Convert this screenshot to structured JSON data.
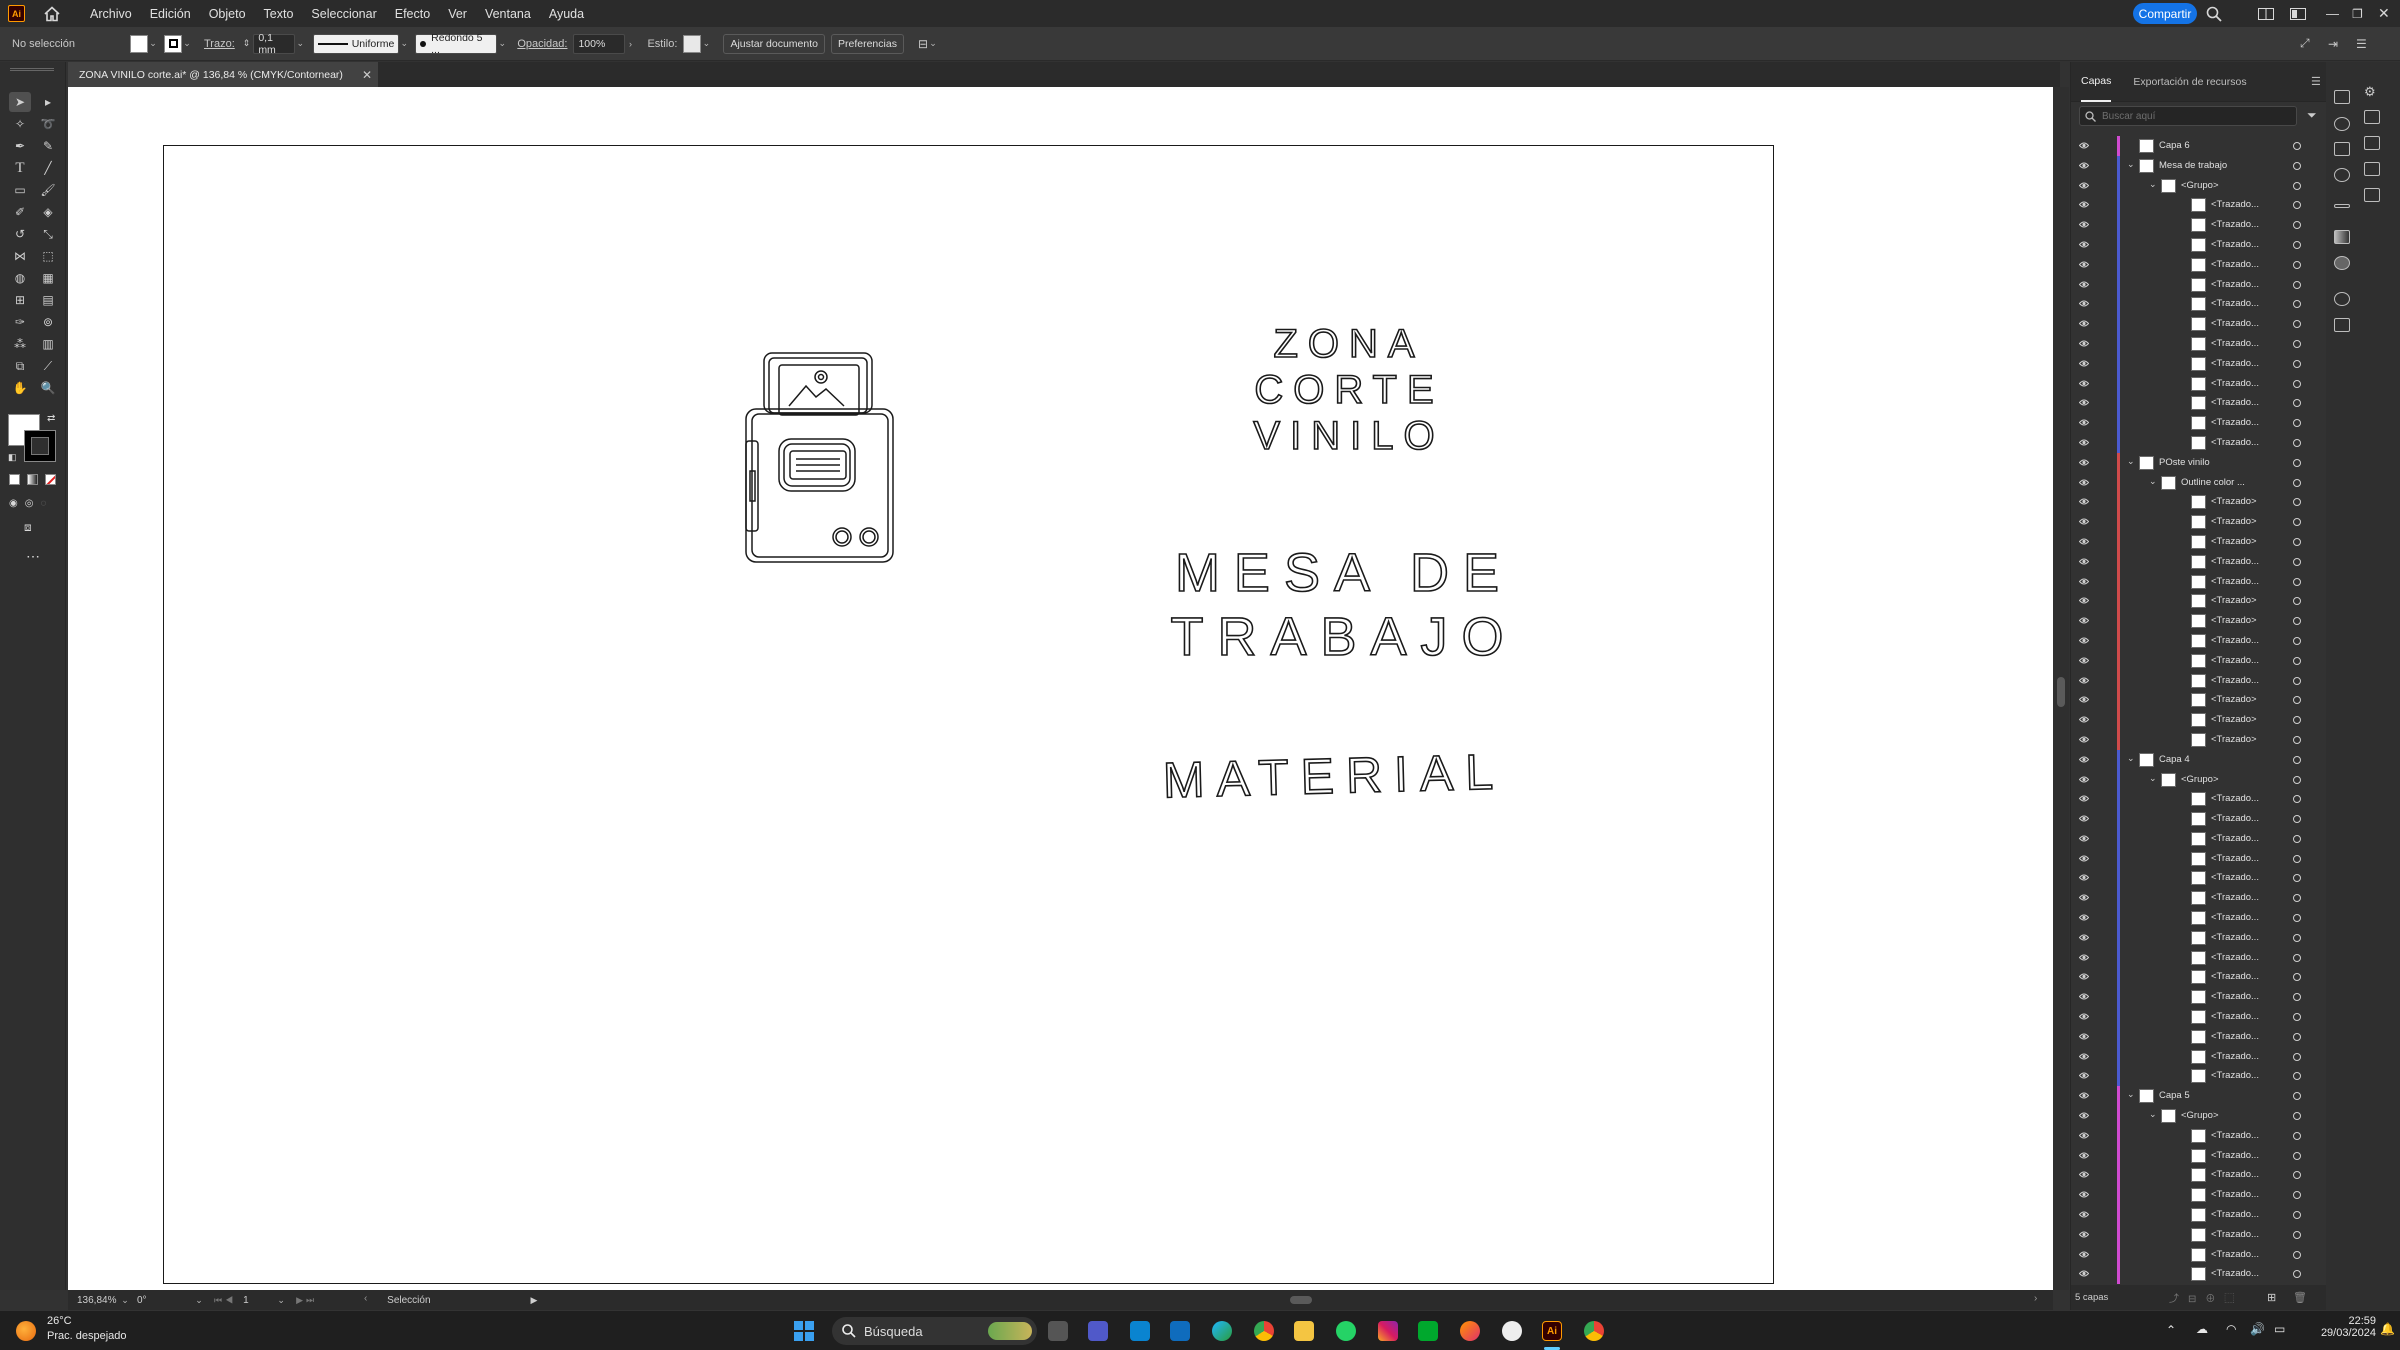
{
  "app": {
    "logo": "Ai"
  },
  "menubar": {
    "items": [
      "Archivo",
      "Edición",
      "Objeto",
      "Texto",
      "Seleccionar",
      "Efecto",
      "Ver",
      "Ventana",
      "Ayuda"
    ],
    "share_label": "Compartir"
  },
  "controlbar": {
    "selection": "No selección",
    "stroke_label": "Trazo:",
    "stroke_value": "0,1 mm",
    "profile": "Uniforme",
    "brush": "Redondo 5 ...",
    "opacity_label": "Opacidad:",
    "opacity_value": "100%",
    "style_label": "Estilo:",
    "fit_button": "Ajustar documento",
    "prefs_button": "Preferencias"
  },
  "document": {
    "tab_title": "ZONA VINILO corte.ai* @ 136,84 % (CMYK/Contornear)",
    "text_zona_1": "ZONA",
    "text_zona_2": "CORTE",
    "text_zona_3": "VINILO",
    "text_mesa_1": "MESA DE",
    "text_mesa_2": "TRABAJO",
    "text_material": "MATERIAL"
  },
  "statusbar": {
    "zoom": "136,84%",
    "rotation": "0°",
    "artboard": "1",
    "tool": "Selección"
  },
  "layers_panel": {
    "tabs": [
      "Capas",
      "Exportación de recursos"
    ],
    "search_placeholder": "Buscar aquí",
    "footer": "5 capas",
    "rows": [
      {
        "name": "Capa 6",
        "level": 0,
        "expandable": false,
        "color": "#d04bd0"
      },
      {
        "name": "Mesa de trabajo",
        "level": 0,
        "expandable": true,
        "color": "#4b5bd0"
      },
      {
        "name": "<Grupo>",
        "level": 1,
        "expandable": true,
        "color": "#4b5bd0"
      },
      {
        "name": "<Trazado...",
        "level": 2,
        "expandable": false,
        "color": "#4b5bd0"
      },
      {
        "name": "<Trazado...",
        "level": 2,
        "expandable": false,
        "color": "#4b5bd0"
      },
      {
        "name": "<Trazado...",
        "level": 2,
        "expandable": false,
        "color": "#4b5bd0"
      },
      {
        "name": "<Trazado...",
        "level": 2,
        "expandable": false,
        "color": "#4b5bd0"
      },
      {
        "name": "<Trazado...",
        "level": 2,
        "expandable": false,
        "color": "#4b5bd0"
      },
      {
        "name": "<Trazado...",
        "level": 2,
        "expandable": false,
        "color": "#4b5bd0"
      },
      {
        "name": "<Trazado...",
        "level": 2,
        "expandable": false,
        "color": "#4b5bd0"
      },
      {
        "name": "<Trazado...",
        "level": 2,
        "expandable": false,
        "color": "#4b5bd0"
      },
      {
        "name": "<Trazado...",
        "level": 2,
        "expandable": false,
        "color": "#4b5bd0"
      },
      {
        "name": "<Trazado...",
        "level": 2,
        "expandable": false,
        "color": "#4b5bd0"
      },
      {
        "name": "<Trazado...",
        "level": 2,
        "expandable": false,
        "color": "#4b5bd0"
      },
      {
        "name": "<Trazado...",
        "level": 2,
        "expandable": false,
        "color": "#4b5bd0"
      },
      {
        "name": "<Trazado...",
        "level": 2,
        "expandable": false,
        "color": "#4b5bd0"
      },
      {
        "name": "POste vinilo",
        "level": 0,
        "expandable": true,
        "color": "#d04b4b"
      },
      {
        "name": "Outline color ...",
        "level": 1,
        "expandable": true,
        "color": "#d04b4b"
      },
      {
        "name": "<Trazado>",
        "level": 2,
        "expandable": false,
        "color": "#d04b4b"
      },
      {
        "name": "<Trazado>",
        "level": 2,
        "expandable": false,
        "color": "#d04b4b"
      },
      {
        "name": "<Trazado>",
        "level": 2,
        "expandable": false,
        "color": "#d04b4b"
      },
      {
        "name": "<Trazado...",
        "level": 2,
        "expandable": false,
        "color": "#d04b4b"
      },
      {
        "name": "<Trazado...",
        "level": 2,
        "expandable": false,
        "color": "#d04b4b"
      },
      {
        "name": "<Trazado>",
        "level": 2,
        "expandable": false,
        "color": "#d04b4b"
      },
      {
        "name": "<Trazado>",
        "level": 2,
        "expandable": false,
        "color": "#d04b4b"
      },
      {
        "name": "<Trazado...",
        "level": 2,
        "expandable": false,
        "color": "#d04b4b"
      },
      {
        "name": "<Trazado...",
        "level": 2,
        "expandable": false,
        "color": "#d04b4b"
      },
      {
        "name": "<Trazado...",
        "level": 2,
        "expandable": false,
        "color": "#d04b4b"
      },
      {
        "name": "<Trazado>",
        "level": 2,
        "expandable": false,
        "color": "#d04b4b"
      },
      {
        "name": "<Trazado>",
        "level": 2,
        "expandable": false,
        "color": "#d04b4b"
      },
      {
        "name": "<Trazado>",
        "level": 2,
        "expandable": false,
        "color": "#d04b4b"
      },
      {
        "name": "Capa 4",
        "level": 0,
        "expandable": true,
        "color": "#4b5bd0"
      },
      {
        "name": "<Grupo>",
        "level": 1,
        "expandable": true,
        "color": "#4b5bd0"
      },
      {
        "name": "<Trazado...",
        "level": 2,
        "expandable": false,
        "color": "#4b5bd0"
      },
      {
        "name": "<Trazado...",
        "level": 2,
        "expandable": false,
        "color": "#4b5bd0"
      },
      {
        "name": "<Trazado...",
        "level": 2,
        "expandable": false,
        "color": "#4b5bd0"
      },
      {
        "name": "<Trazado...",
        "level": 2,
        "expandable": false,
        "color": "#4b5bd0"
      },
      {
        "name": "<Trazado...",
        "level": 2,
        "expandable": false,
        "color": "#4b5bd0"
      },
      {
        "name": "<Trazado...",
        "level": 2,
        "expandable": false,
        "color": "#4b5bd0"
      },
      {
        "name": "<Trazado...",
        "level": 2,
        "expandable": false,
        "color": "#4b5bd0"
      },
      {
        "name": "<Trazado...",
        "level": 2,
        "expandable": false,
        "color": "#4b5bd0"
      },
      {
        "name": "<Trazado...",
        "level": 2,
        "expandable": false,
        "color": "#4b5bd0"
      },
      {
        "name": "<Trazado...",
        "level": 2,
        "expandable": false,
        "color": "#4b5bd0"
      },
      {
        "name": "<Trazado...",
        "level": 2,
        "expandable": false,
        "color": "#4b5bd0"
      },
      {
        "name": "<Trazado...",
        "level": 2,
        "expandable": false,
        "color": "#4b5bd0"
      },
      {
        "name": "<Trazado...",
        "level": 2,
        "expandable": false,
        "color": "#4b5bd0"
      },
      {
        "name": "<Trazado...",
        "level": 2,
        "expandable": false,
        "color": "#4b5bd0"
      },
      {
        "name": "<Trazado...",
        "level": 2,
        "expandable": false,
        "color": "#4b5bd0"
      },
      {
        "name": "Capa 5",
        "level": 0,
        "expandable": true,
        "color": "#d04bd0"
      },
      {
        "name": "<Grupo>",
        "level": 1,
        "expandable": true,
        "color": "#d04bd0"
      },
      {
        "name": "<Trazado...",
        "level": 2,
        "expandable": false,
        "color": "#d04bd0"
      },
      {
        "name": "<Trazado...",
        "level": 2,
        "expandable": false,
        "color": "#d04bd0"
      },
      {
        "name": "<Trazado...",
        "level": 2,
        "expandable": false,
        "color": "#d04bd0"
      },
      {
        "name": "<Trazado...",
        "level": 2,
        "expandable": false,
        "color": "#d04bd0"
      },
      {
        "name": "<Trazado...",
        "level": 2,
        "expandable": false,
        "color": "#d04bd0"
      },
      {
        "name": "<Trazado...",
        "level": 2,
        "expandable": false,
        "color": "#d04bd0"
      },
      {
        "name": "<Trazado...",
        "level": 2,
        "expandable": false,
        "color": "#d04bd0"
      },
      {
        "name": "<Trazado...",
        "level": 2,
        "expandable": false,
        "color": "#d04bd0"
      }
    ]
  },
  "taskbar": {
    "weather_temp": "26°C",
    "weather_desc": "Prac. despejado",
    "search_placeholder": "Búsqueda",
    "time": "22:59",
    "date": "29/03/2024"
  }
}
